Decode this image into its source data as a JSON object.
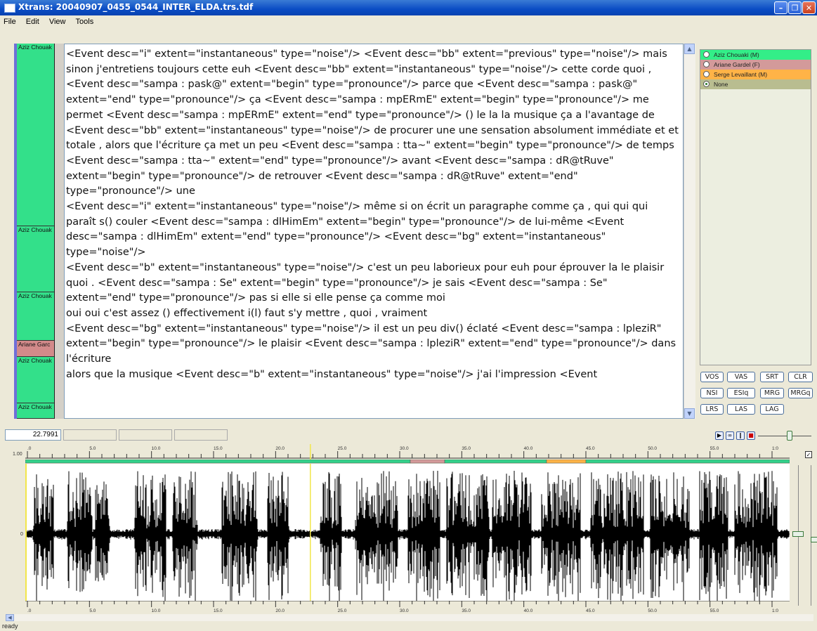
{
  "window": {
    "title": "Xtrans: 20040907_0455_0544_INTER_ELDA.trs.tdf"
  },
  "menu": [
    "File",
    "Edit",
    "View",
    "Tools"
  ],
  "turns": [
    {
      "speaker": "Aziz Chouak",
      "color": "#33e08a"
    },
    {
      "speaker": "Aziz Chouak",
      "color": "#33e08a"
    },
    {
      "speaker": "Aziz Chouak",
      "color": "#33e08a"
    },
    {
      "speaker": "Ariane Garc",
      "color": "#d38a8a"
    },
    {
      "speaker": "Aziz Chouak",
      "color": "#33e08a"
    },
    {
      "speaker": "Aziz Chouak",
      "color": "#33e08a"
    }
  ],
  "transcript": [
    " <Event desc=\"i\" extent=\"instantaneous\" type=\"noise\"/>  <Event desc=\"bb\" extent=\"previous\" type=\"noise\"/> mais sinon j'entretiens toujours cette euh <Event desc=\"bb\" extent=\"instantaneous\" type=\"noise\"/> cette corde quoi , <Event desc=\"sampa : pask@\" extent=\"begin\" type=\"pronounce\"/> parce que <Event desc=\"sampa : pask@\" extent=\"end\" type=\"pronounce\"/> ça <Event desc=\"sampa : mpERmE\" extent=\"begin\" type=\"pronounce\"/> me permet <Event desc=\"sampa : mpERmE\" extent=\"end\" type=\"pronounce\"/> () le la la musique ça a l'avantage de <Event desc=\"bb\" extent=\"instantaneous\" type=\"noise\"/> de procurer une une sensation absolument immédiate et et totale , alors que l'écriture ça met un peu <Event desc=\"sampa : tta~\" extent=\"begin\" type=\"pronounce\"/> de temps <Event desc=\"sampa : tta~\" extent=\"end\" type=\"pronounce\"/> avant <Event desc=\"sampa : dR@tRuve\" extent=\"begin\" type=\"pronounce\"/> de retrouver <Event desc=\"sampa : dR@tRuve\" extent=\"end\" type=\"pronounce\"/> une",
    " <Event desc=\"i\" extent=\"instantaneous\" type=\"noise\"/> même si on écrit un paragraphe comme ça , qui qui qui paraît s() couler <Event desc=\"sampa : dlHimEm\" extent=\"begin\" type=\"pronounce\"/> de lui-même <Event desc=\"sampa : dlHimEm\" extent=\"end\" type=\"pronounce\"/>  <Event desc=\"bg\" extent=\"instantaneous\" type=\"noise\"/>",
    " <Event desc=\"b\" extent=\"instantaneous\" type=\"noise\"/> c'est un peu laborieux pour euh pour éprouver la le plaisir quoi . <Event desc=\"sampa : Se\" extent=\"begin\" type=\"pronounce\"/> je sais <Event desc=\"sampa : Se\" extent=\"end\" type=\"pronounce\"/> pas si elle si elle pense ça comme moi",
    "oui oui c'est assez () effectivement i(l) faut s'y mettre , quoi , vraiment",
    " <Event desc=\"bg\" extent=\"instantaneous\" type=\"noise\"/> il est un peu div() éclaté <Event desc=\"sampa : lpleziR\" extent=\"begin\" type=\"pronounce\"/> le plaisir <Event desc=\"sampa : lpleziR\" extent=\"end\" type=\"pronounce\"/> dans l'écriture",
    "alors que la musique <Event desc=\"b\" extent=\"instantaneous\" type=\"noise\"/> j'ai l'impression <Event"
  ],
  "speakers": [
    {
      "label": "Aziz Chouaki (M)",
      "color": "#33ee88",
      "selected": false
    },
    {
      "label": "Ariane Gardel (F)",
      "color": "#d39a9a",
      "selected": false
    },
    {
      "label": "Serge Levaillant (M)",
      "color": "#ffb347",
      "selected": false
    },
    {
      "label": "None",
      "color": "#b9bd90",
      "selected": true
    }
  ],
  "tool_buttons": [
    [
      "VOS",
      "VAS",
      "SRT",
      "CLR"
    ],
    [
      "NSI",
      "ESIq",
      "MRG",
      "MRGq"
    ],
    [
      "LRS",
      "LAS",
      "LAG"
    ]
  ],
  "time_display": "22.7991",
  "ruler_labels": [
    ".0",
    "5.0",
    "10.0",
    "15.0",
    "20.0",
    "25.0",
    "30.0",
    "35.0",
    "40.0",
    "45.0",
    "50.0",
    "55.0",
    "1:0"
  ],
  "yaxis": {
    "top": "1.00",
    "zero": "0"
  },
  "cursor_time": 22.8,
  "view_seconds": 60,
  "status": "ready"
}
